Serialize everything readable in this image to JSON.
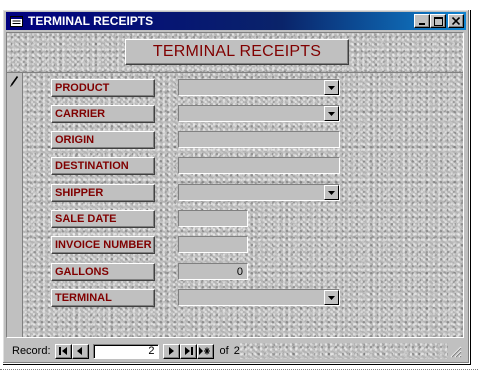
{
  "window": {
    "title": "TERMINAL RECEIPTS",
    "buttons": {
      "minimize": "minimize-icon",
      "maximize": "maximize-icon",
      "close": "close-icon"
    }
  },
  "form": {
    "header_title": "TERMINAL RECEIPTS",
    "fields": [
      {
        "label": "PRODUCT",
        "value": "",
        "type": "combo"
      },
      {
        "label": "CARRIER",
        "value": "",
        "type": "combo"
      },
      {
        "label": "ORIGIN",
        "value": "",
        "type": "text"
      },
      {
        "label": "DESTINATION",
        "value": "",
        "type": "text"
      },
      {
        "label": "SHIPPER",
        "value": "",
        "type": "combo"
      },
      {
        "label": "SALE DATE",
        "value": "",
        "type": "text"
      },
      {
        "label": "INVOICE NUMBER",
        "value": "",
        "type": "text"
      },
      {
        "label": "GALLONS",
        "value": "0",
        "type": "text"
      },
      {
        "label": "TERMINAL",
        "value": "",
        "type": "combo"
      }
    ]
  },
  "navigation": {
    "label": "Record:",
    "current": "2",
    "of_label": "of",
    "total": "2"
  },
  "colors": {
    "label_text": "#800000",
    "title_bar": "#000080",
    "face": "#c0c0c0"
  }
}
